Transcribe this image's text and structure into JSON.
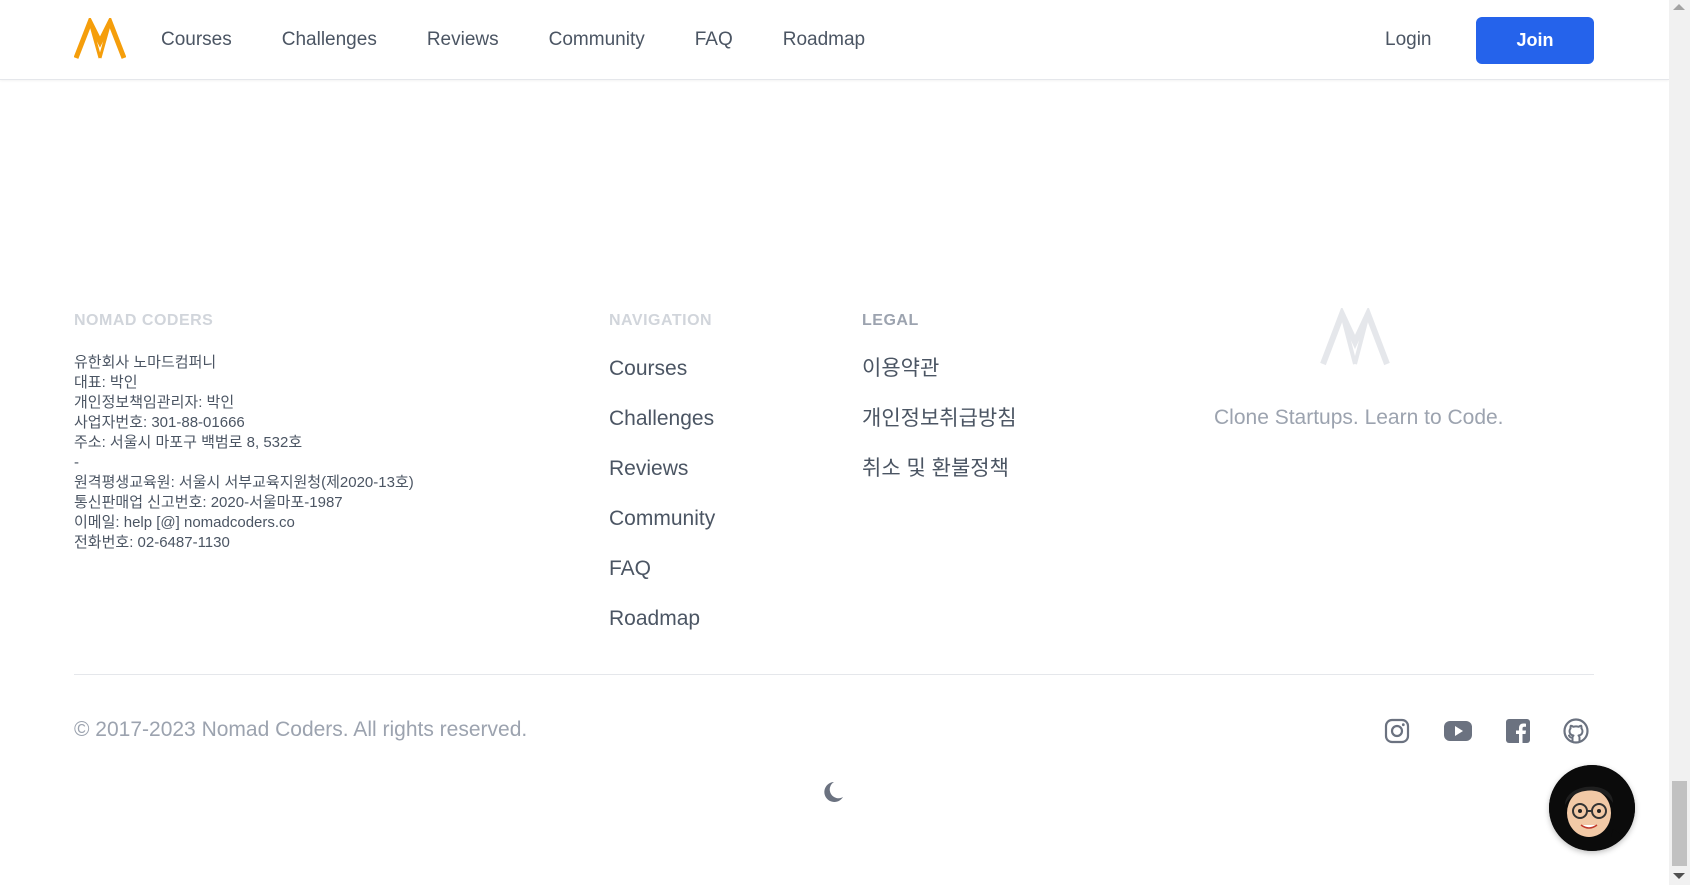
{
  "header": {
    "logo_icon": "nomad-coders-logo-icon",
    "nav": [
      "Courses",
      "Challenges",
      "Reviews",
      "Community",
      "FAQ",
      "Roadmap"
    ],
    "login_label": "Login",
    "join_label": "Join"
  },
  "footer": {
    "company_title": "NOMAD CODERS",
    "company_info": [
      "유한회사 노마드컴퍼니",
      "대표: 박인",
      "개인정보책임관리자: 박인",
      "사업자번호: 301-88-01666",
      "주소: 서울시 마포구 백범로 8, 532호",
      "-",
      "원격평생교육원: 서울시 서부교육지원청(제2020-13호)",
      "통신판매업 신고번호: 2020-서울마포-1987",
      "이메일: help [@] nomadcoders.co",
      "전화번호: 02-6487-1130"
    ],
    "navigation_title": "NAVIGATION",
    "navigation": [
      "Courses",
      "Challenges",
      "Reviews",
      "Community",
      "FAQ",
      "Roadmap"
    ],
    "legal_title": "LEGAL",
    "legal": [
      "이용약관",
      "개인정보취급방침",
      "취소 및 환불정책"
    ],
    "tagline": "Clone Startups. Learn to Code.",
    "copyright": "© 2017-2023 Nomad Coders. All rights reserved.",
    "socials": [
      "instagram-icon",
      "youtube-icon",
      "facebook-icon",
      "github-icon"
    ],
    "theme_toggle_icon": "moon-icon"
  },
  "colors": {
    "accent": "#2563eb",
    "brand_orange": "#f59e0b",
    "muted": "#9ca3af"
  }
}
